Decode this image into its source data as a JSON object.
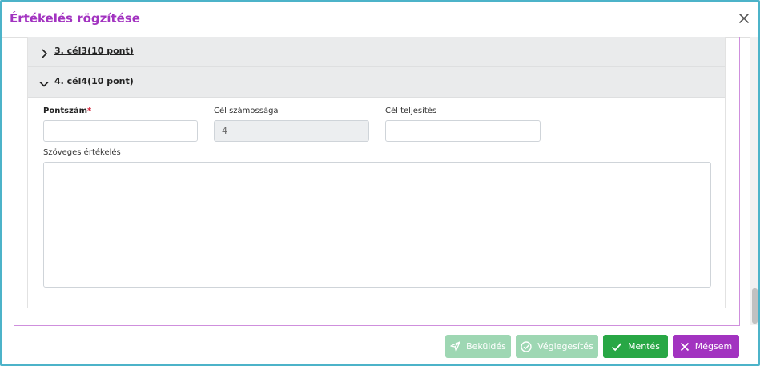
{
  "dialog": {
    "title": "Értékelés rögzítése"
  },
  "accordion": {
    "items": [
      {
        "label": "3. cél3(10 pont)",
        "state": "collapsed"
      },
      {
        "label": "4. cél4(10 pont)",
        "state": "expanded"
      }
    ]
  },
  "form": {
    "score_label": "Pontszám",
    "score_required_mark": "*",
    "score_value": "",
    "goal_count_label": "Cél számossága",
    "goal_count_value": "4",
    "goal_completion_label": "Cél teljesítés",
    "goal_completion_value": "",
    "text_eval_label": "Szöveges értékelés",
    "text_eval_value": ""
  },
  "footer": {
    "send_label": "Beküldés",
    "finalize_label": "Véglegesítés",
    "save_label": "Mentés",
    "cancel_label": "Mégsem"
  },
  "colors": {
    "title": "#a233c0",
    "save": "#28a745",
    "cancel": "#a233c0",
    "disabled_green": "#9ed7b3",
    "required": "#d3233a"
  }
}
